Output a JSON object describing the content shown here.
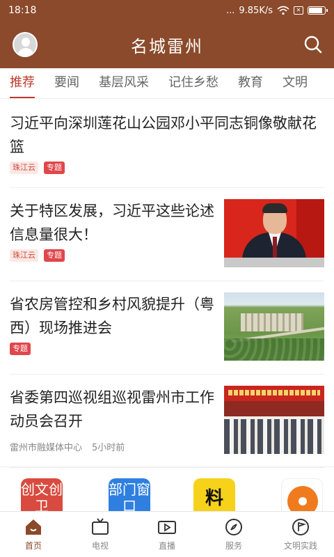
{
  "status": {
    "time": "18:18",
    "signal_dots": "...",
    "speed": "9.85K/s",
    "battery_level": 0.8
  },
  "header": {
    "title": "名城雷州",
    "accent_color": "#8b4a2b"
  },
  "tabs": [
    {
      "label": "推荐",
      "active": true
    },
    {
      "label": "要闻"
    },
    {
      "label": "基层风采"
    },
    {
      "label": "记住乡愁"
    },
    {
      "label": "教育"
    },
    {
      "label": "文明"
    }
  ],
  "feed": [
    {
      "headline": "习近平向深圳莲花山公园邓小平同志铜像敬献花篮",
      "source_tag": "珠江云",
      "special_tag": "专题"
    },
    {
      "headline": "关于特区发展，习近平这些论述信息量很大！",
      "source_tag": "珠江云",
      "special_tag": "专题"
    },
    {
      "headline": "省农房管控和乡村风貌提升（粤西）现场推进会",
      "special_tag": "专题"
    },
    {
      "headline": "省委第四巡视组巡视雷州市工作动员会召开",
      "source": "雷州市融媒体中心",
      "time": "5小时前"
    }
  ],
  "services": [
    {
      "label": "创文创卫",
      "icon": "chuangwen-icon",
      "color": "#d94b3f"
    },
    {
      "label": "部门窗口",
      "icon": "department-icon",
      "color": "#2f7fe0"
    },
    {
      "label": "料",
      "icon": "liao-icon",
      "color": "#f6d21a"
    },
    {
      "label": "",
      "icon": "broadcast-icon",
      "color": "#f07a1e"
    }
  ],
  "bottom_nav": [
    {
      "label": "首页",
      "icon": "home-icon",
      "active": true
    },
    {
      "label": "电视",
      "icon": "tv-icon"
    },
    {
      "label": "直播",
      "icon": "live-video-icon"
    },
    {
      "label": "服务",
      "icon": "compass-icon"
    },
    {
      "label": "文明实践",
      "icon": "flag-icon"
    }
  ]
}
